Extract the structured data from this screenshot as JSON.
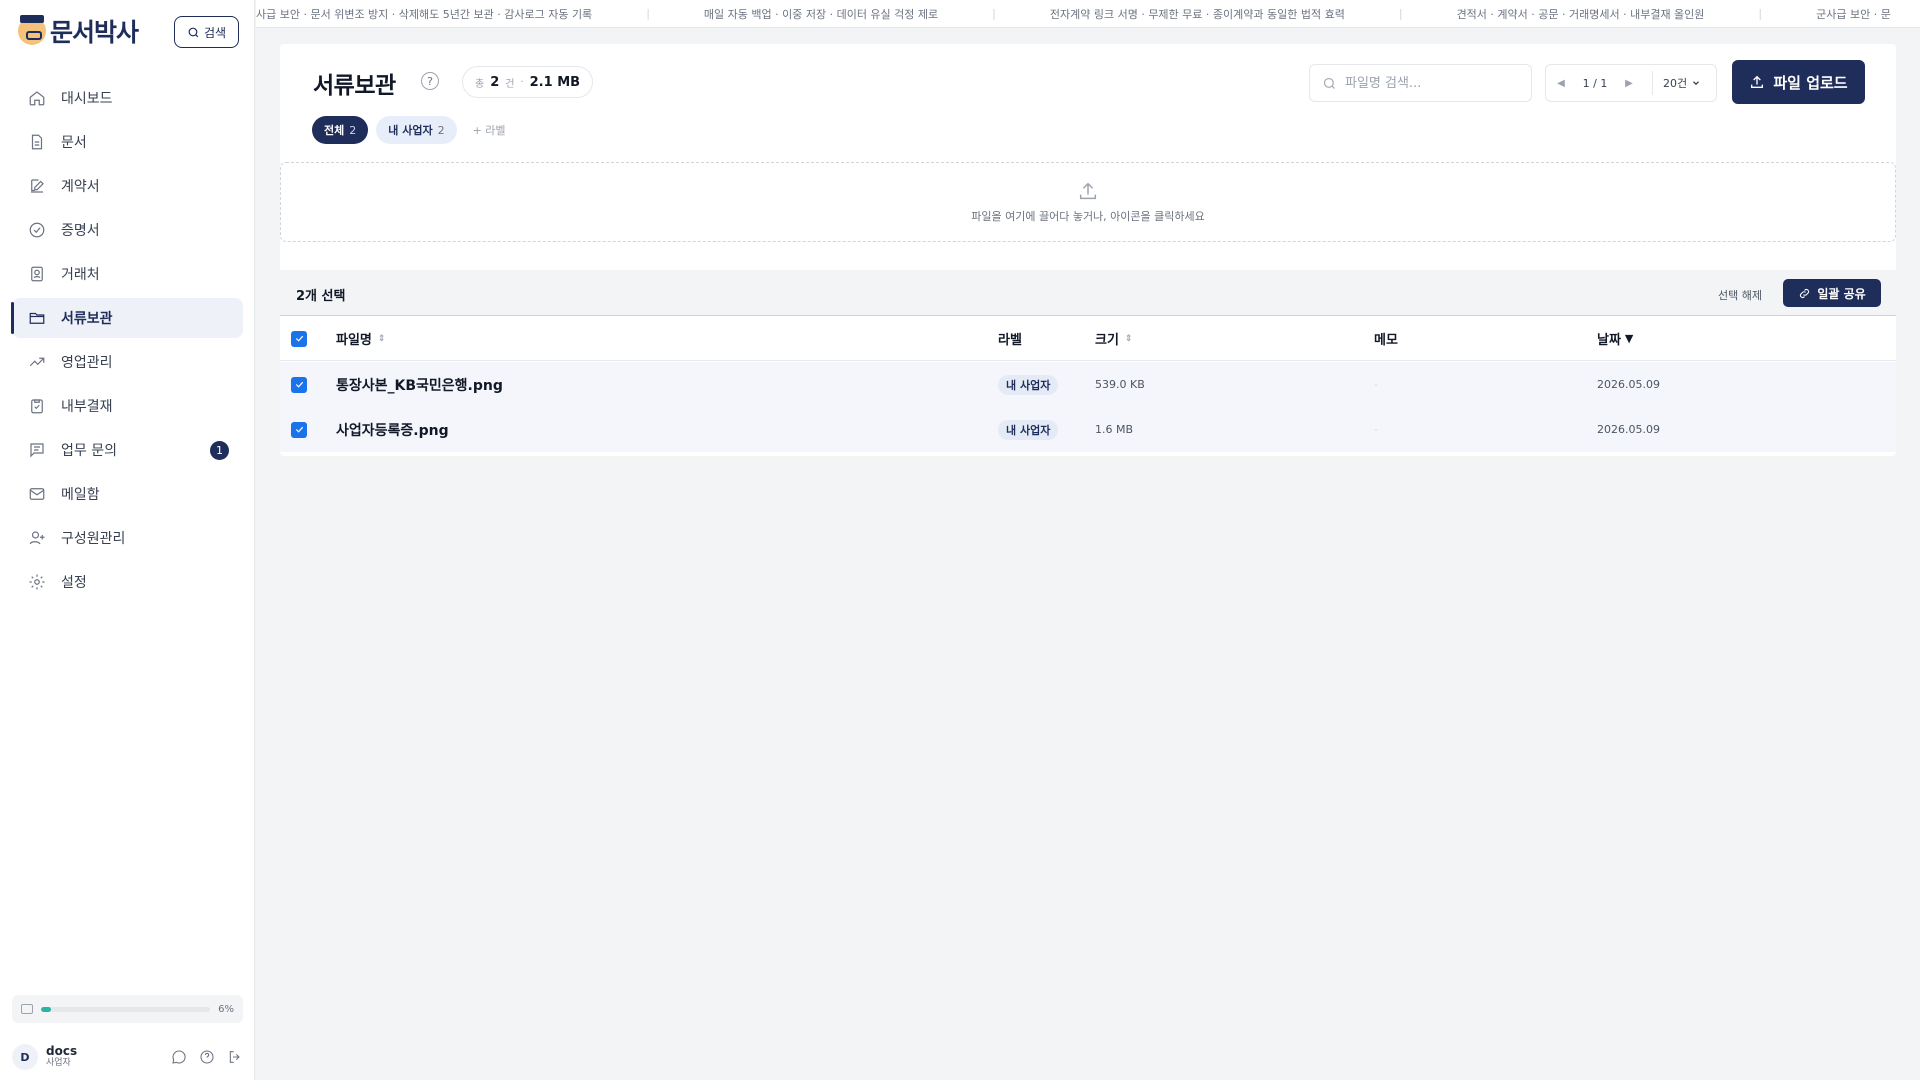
{
  "app": {
    "name": "문서박사",
    "search_label": "검색"
  },
  "sidebar": {
    "items": [
      {
        "label": "대시보드",
        "icon": "home-icon"
      },
      {
        "label": "문서",
        "icon": "document-icon"
      },
      {
        "label": "계약서",
        "icon": "edit-icon"
      },
      {
        "label": "증명서",
        "icon": "check-circle-icon"
      },
      {
        "label": "거래처",
        "icon": "contact-icon"
      },
      {
        "label": "서류보관",
        "icon": "folder-icon",
        "active": true
      },
      {
        "label": "영업관리",
        "icon": "trend-icon"
      },
      {
        "label": "내부결재",
        "icon": "clipboard-icon"
      },
      {
        "label": "업무 문의",
        "icon": "message-icon",
        "badge": "1"
      },
      {
        "label": "메일함",
        "icon": "mail-icon"
      },
      {
        "label": "구성원관리",
        "icon": "user-add-icon"
      },
      {
        "label": "설정",
        "icon": "gear-icon"
      }
    ],
    "storage": {
      "percent_label": "6%",
      "fill": 0.06
    },
    "user": {
      "initial": "D",
      "name": "docs",
      "role": "사업자"
    }
  },
  "ticker": {
    "items": [
      "사급 보안 · 문서 위변조 방지 · 삭제해도 5년간 보관 · 감사로그 자동 기록",
      "매일 자동 백업 · 이중 저장 · 데이터 유실 걱정 제로",
      "전자계약 링크 서명 · 무제한 무료 · 종이계약과 동일한 법적 효력",
      "견적서 · 계약서 · 공문 · 거래명세서 · 내부결재 올인원",
      "군사급 보안 · 문"
    ]
  },
  "page": {
    "title": "서류보관",
    "help": "?",
    "stats": {
      "total_prefix": "총",
      "count": "2",
      "count_unit": "건",
      "dot": "·",
      "size": "2.1 MB"
    },
    "chips": {
      "all_label": "전체",
      "all_count": "2",
      "mine_label": "내 사업자",
      "mine_count": "2",
      "add_label": "+ 라벨"
    },
    "search_placeholder": "파일명 검색...",
    "pager": {
      "prev": "◀",
      "page": "1 / 1",
      "next": "▶",
      "size": "20건"
    },
    "upload_label": "파일 업로드",
    "dropzone_text": "파일을 여기에 끌어다 놓거나, 아이콘을 클릭하세요",
    "selection": {
      "count": "2개 선택",
      "clear": "선택 해제",
      "share": "일괄 공유"
    },
    "columns": {
      "name": "파일명",
      "label": "라벨",
      "size": "크기",
      "memo": "메모",
      "date": "날짜"
    },
    "rows": [
      {
        "name": "통장사본_KB국민은행.png",
        "label": "내 사업자",
        "size": "539.0 KB",
        "memo": "-",
        "date": "2026.05.09"
      },
      {
        "name": "사업자등록증.png",
        "label": "내 사업자",
        "size": "1.6 MB",
        "memo": "-",
        "date": "2026.05.09"
      }
    ]
  },
  "colors": {
    "primary": "#1e2d5a",
    "checkbox": "#1a73e8",
    "storage": "#2bb3a0"
  }
}
